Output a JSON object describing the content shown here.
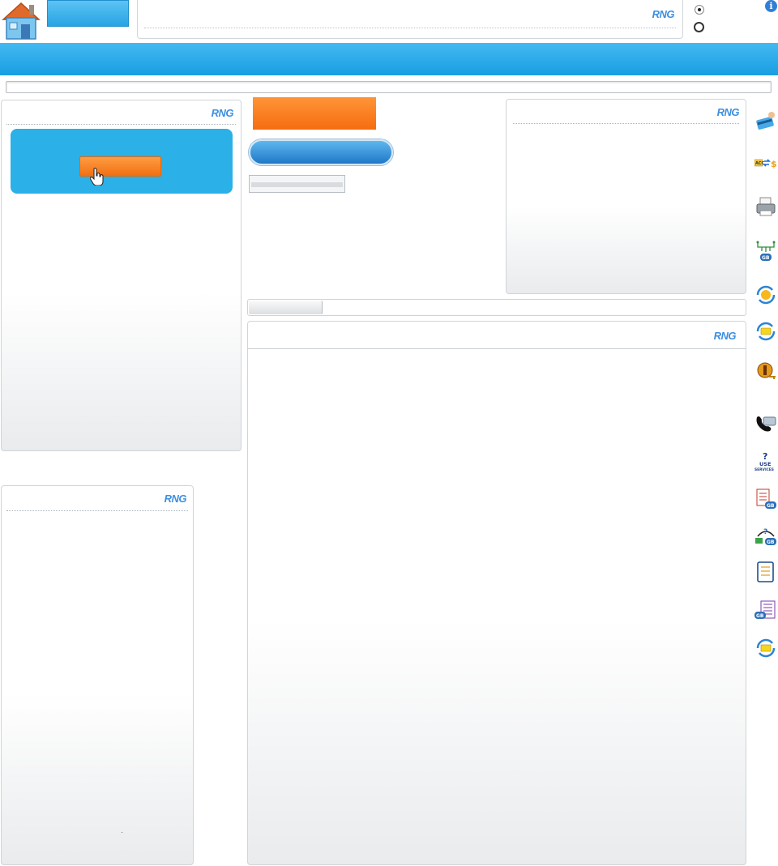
{
  "header": {
    "brand": "RNG",
    "info_glyph": "i"
  },
  "panels": {
    "left_top_brand": "RNG",
    "left_bottom_brand": "RNG",
    "right_top_brand": "RNG",
    "main_brand": "RNG"
  },
  "icons": [
    "home-icon",
    "credit-card-icon",
    "currency-exchange-icon",
    "printer-icon",
    "network-gb-icon",
    "sync-face-icon",
    "sync-card-icon",
    "lottery-key-icon",
    "phone-payment-icon",
    "use-services-icon",
    "document-gb-icon",
    "question-gb-icon",
    "checklist-icon",
    "list-gb-icon",
    "sync-note-icon"
  ],
  "side_icon_texts": {
    "acc": "ACC",
    "use": "USE",
    "services": "SERVICES",
    "gb": "GB",
    "q": "?"
  },
  "colors": {
    "brand_blue": "#27a3e4",
    "accent_orange": "#f56d10",
    "promo_blue": "#2bb0e8"
  }
}
